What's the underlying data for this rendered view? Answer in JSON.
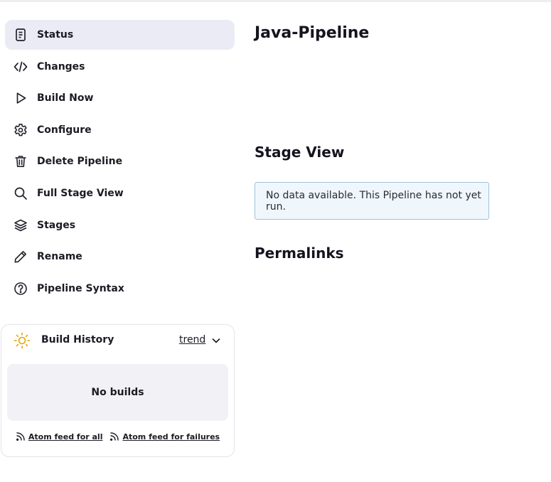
{
  "sidebar": {
    "items": [
      {
        "label": "Status",
        "icon": "status-doc-icon",
        "active": true
      },
      {
        "label": "Changes",
        "icon": "code-icon"
      },
      {
        "label": "Build Now",
        "icon": "play-icon"
      },
      {
        "label": "Configure",
        "icon": "gear-icon"
      },
      {
        "label": "Delete Pipeline",
        "icon": "trash-icon"
      },
      {
        "label": "Full Stage View",
        "icon": "search-icon"
      },
      {
        "label": "Stages",
        "icon": "layers-icon"
      },
      {
        "label": "Rename",
        "icon": "pencil-icon"
      },
      {
        "label": "Pipeline Syntax",
        "icon": "help-circle-icon"
      }
    ]
  },
  "build_history": {
    "title": "Build History",
    "trend_label": "trend",
    "empty_text": "No builds",
    "feed_all": "Atom feed for all",
    "feed_failures": "Atom feed for failures",
    "sun_color": "#e8a200"
  },
  "main": {
    "title": "Java-Pipeline",
    "stage_view_title": "Stage View",
    "stage_notice": "No data available. This Pipeline has not yet run.",
    "permalinks_title": "Permalinks"
  }
}
